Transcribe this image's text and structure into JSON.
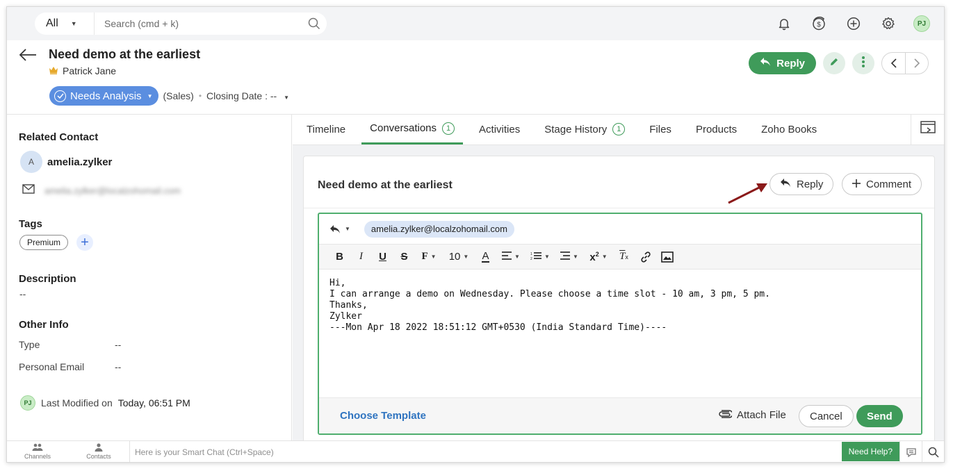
{
  "search": {
    "scope": "All",
    "placeholder": "Search (cmd + k)"
  },
  "user": {
    "initials": "PJ"
  },
  "record": {
    "title": "Need demo at the earliest",
    "owner": "Patrick Jane",
    "stage": "Needs Analysis",
    "pipeline": "(Sales)",
    "closing_date_label": "Closing Date : --"
  },
  "header_actions": {
    "reply_label": "Reply"
  },
  "left": {
    "related_contact_heading": "Related Contact",
    "contact_initial": "A",
    "contact_name": "amelia.zylker",
    "contact_email": "amelia.zylker@localzohomail.com",
    "tags_heading": "Tags",
    "tags": [
      "Premium"
    ],
    "description_heading": "Description",
    "description_value": "--",
    "other_info_heading": "Other Info",
    "other_info": [
      {
        "label": "Type",
        "value": "--"
      },
      {
        "label": "Personal Email",
        "value": "--"
      }
    ],
    "last_modified_label": "Last Modified on",
    "last_modified_value": "Today, 06:51 PM"
  },
  "tabs": [
    {
      "label": "Timeline"
    },
    {
      "label": "Conversations",
      "count": "1",
      "active": true
    },
    {
      "label": "Activities"
    },
    {
      "label": "Stage History",
      "count": "1"
    },
    {
      "label": "Files"
    },
    {
      "label": "Products"
    },
    {
      "label": "Zoho Books"
    }
  ],
  "conversation": {
    "title": "Need demo at the earliest",
    "reply_label": "Reply",
    "comment_label": "Comment"
  },
  "composer": {
    "to_email": "amelia.zylker@localzohomail.com",
    "font_size": "10",
    "body_lines": [
      "Hi,",
      "",
      "I can arrange a demo on Wednesday. Please choose a time slot - 10 am, 3 pm, 5 pm.",
      "",
      "Thanks,",
      "Zylker",
      "",
      "",
      "",
      "",
      "---Mon Apr 18 2022 18:51:12 GMT+0530 (India Standard Time)----"
    ],
    "choose_template_label": "Choose Template",
    "attach_label": "Attach File",
    "cancel_label": "Cancel",
    "send_label": "Send"
  },
  "bottom": {
    "channels_label": "Channels",
    "contacts_label": "Contacts",
    "smartchat_placeholder": "Here is your Smart Chat (Ctrl+Space)",
    "need_help_label": "Need Help?"
  },
  "colors": {
    "accent_green": "#3f9b5a",
    "stage_blue": "#5b8ee0",
    "link_blue": "#2f74c0",
    "annotation_red": "#8b1a1a"
  }
}
